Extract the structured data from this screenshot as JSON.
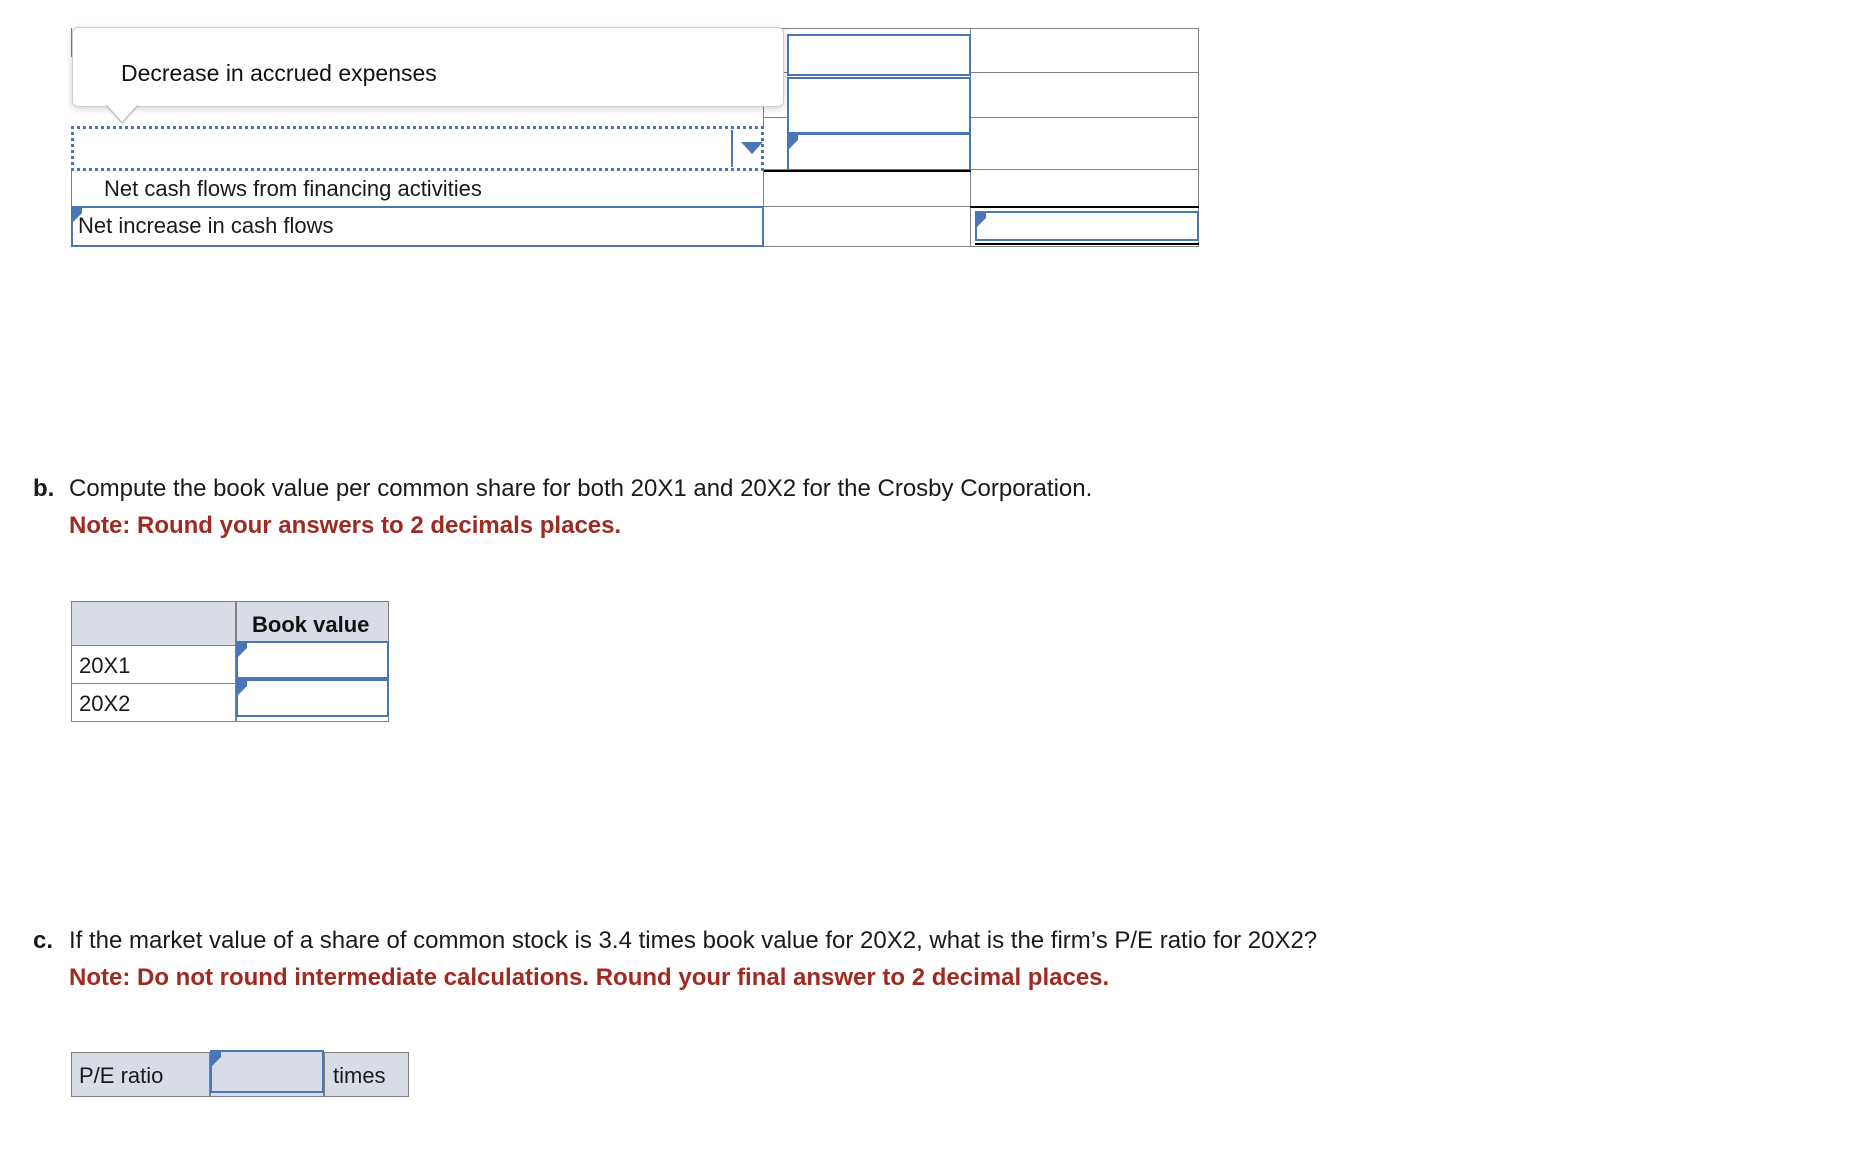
{
  "cashflow_table": {
    "rows": [
      {
        "label": "Net cash flows from financing activities"
      },
      {
        "label": "Net increase in cash flows"
      }
    ],
    "tooltip": {
      "text": "Decrease in accrued expenses"
    },
    "dropdown": {
      "value": "",
      "icon": "chevron-down-icon"
    }
  },
  "part_b": {
    "letter": "b.",
    "question": "Compute the book value per common share for both 20X1 and 20X2 for the Crosby Corporation.",
    "note": "Note: Round your answers to 2 decimals places.",
    "table": {
      "corner_header": "",
      "column_header": "Book value",
      "rows": [
        {
          "label": "20X1",
          "value": ""
        },
        {
          "label": "20X2",
          "value": ""
        }
      ]
    }
  },
  "part_c": {
    "letter": "c.",
    "question": "If the market value of a share of common stock is 3.4 times book value for 20X2, what is the firm’s P/E ratio for 20X2?",
    "note": "Note: Do not round intermediate calculations. Round your final answer to 2 decimal places.",
    "table": {
      "label": "P/E ratio",
      "value": "",
      "unit": "times"
    }
  },
  "colors": {
    "accent_blue": "#4a76b8",
    "header_fill": "#d7dce6",
    "note_red": "#9e2a22",
    "grid_grey": "#808080"
  }
}
